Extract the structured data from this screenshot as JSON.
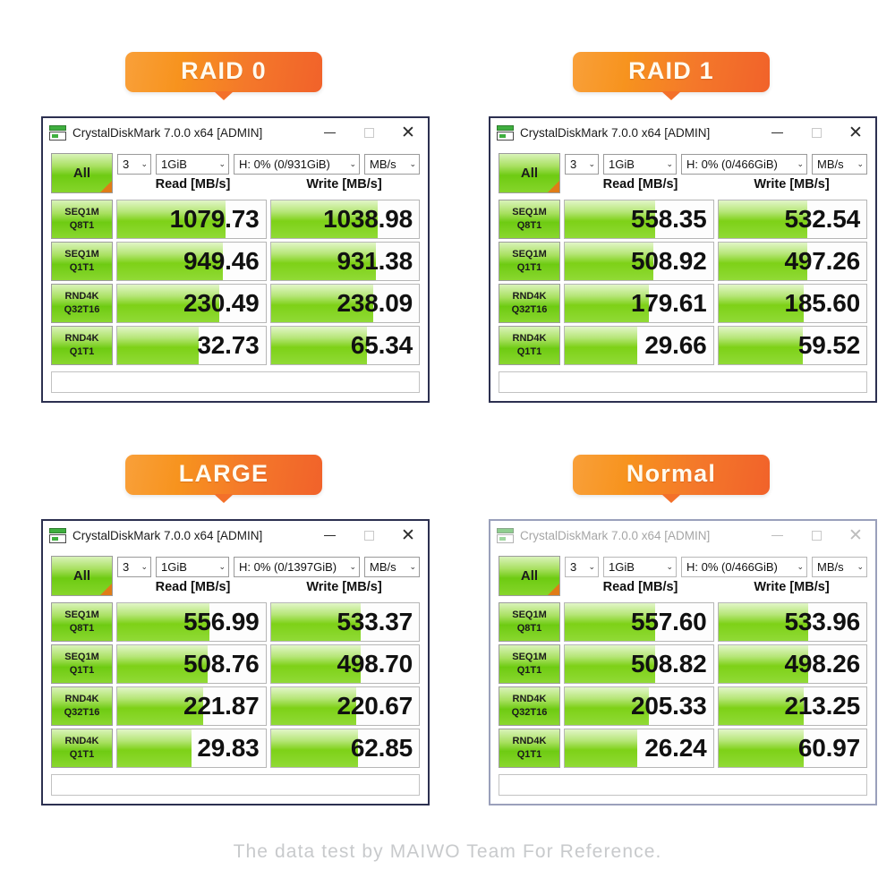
{
  "footer": {
    "text": "The data test by MAIWO Team For Reference."
  },
  "colors": {
    "banner_orange_light": "#f9a03a",
    "banner_orange_dark": "#f1622a",
    "bar_green": "#7ed117",
    "window_border": "#2c3050",
    "footer_gray": "#c8cacc"
  },
  "window_common": {
    "title": "CrystalDiskMark 7.0.0 x64 [ADMIN]",
    "icon": "disk-drive-icon",
    "minimize_label": "—",
    "maximize_label": "☐",
    "close_label": "✕",
    "all_button_label": "All",
    "count_value": "3",
    "size_value": "1GiB",
    "unit_value": "MB/s",
    "read_header": "Read [MB/s]",
    "write_header": "Write [MB/s]",
    "caret": "⌄",
    "row_labels": [
      {
        "top": "SEQ1M",
        "bottom": "Q8T1"
      },
      {
        "top": "SEQ1M",
        "bottom": "Q1T1"
      },
      {
        "top": "RND4K",
        "bottom": "Q32T16"
      },
      {
        "top": "RND4K",
        "bottom": "Q1T1"
      }
    ]
  },
  "panels": [
    {
      "banner": "RAID 0",
      "active": true,
      "drive_value": "H: 0% (0/931GiB)",
      "rows": [
        {
          "read": "1079.73",
          "write": "1038.98",
          "read_fill": 73,
          "write_fill": 72
        },
        {
          "read": "949.46",
          "write": "931.38",
          "read_fill": 71,
          "write_fill": 71
        },
        {
          "read": "230.49",
          "write": "238.09",
          "read_fill": 69,
          "write_fill": 69
        },
        {
          "read": "32.73",
          "write": "65.34",
          "read_fill": 55,
          "write_fill": 65
        }
      ]
    },
    {
      "banner": "RAID 1",
      "active": true,
      "drive_value": "H: 0% (0/466GiB)",
      "rows": [
        {
          "read": "558.35",
          "write": "532.54",
          "read_fill": 61,
          "write_fill": 60
        },
        {
          "read": "508.92",
          "write": "497.26",
          "read_fill": 60,
          "write_fill": 60
        },
        {
          "read": "179.61",
          "write": "185.60",
          "read_fill": 57,
          "write_fill": 58
        },
        {
          "read": "29.66",
          "write": "59.52",
          "read_fill": 49,
          "write_fill": 57
        }
      ]
    },
    {
      "banner": "LARGE",
      "active": true,
      "drive_value": "H: 0% (0/1397GiB)",
      "rows": [
        {
          "read": "556.99",
          "write": "533.37",
          "read_fill": 62,
          "write_fill": 61
        },
        {
          "read": "508.76",
          "write": "498.70",
          "read_fill": 61,
          "write_fill": 61
        },
        {
          "read": "221.87",
          "write": "220.67",
          "read_fill": 58,
          "write_fill": 58
        },
        {
          "read": "29.83",
          "write": "62.85",
          "read_fill": 50,
          "write_fill": 59
        }
      ]
    },
    {
      "banner": "Normal",
      "active": false,
      "drive_value": "H: 0% (0/466GiB)",
      "rows": [
        {
          "read": "557.60",
          "write": "533.96",
          "read_fill": 61,
          "write_fill": 61
        },
        {
          "read": "508.82",
          "write": "498.26",
          "read_fill": 61,
          "write_fill": 61
        },
        {
          "read": "205.33",
          "write": "213.25",
          "read_fill": 57,
          "write_fill": 58
        },
        {
          "read": "26.24",
          "write": "60.97",
          "read_fill": 49,
          "write_fill": 58
        }
      ]
    }
  ]
}
